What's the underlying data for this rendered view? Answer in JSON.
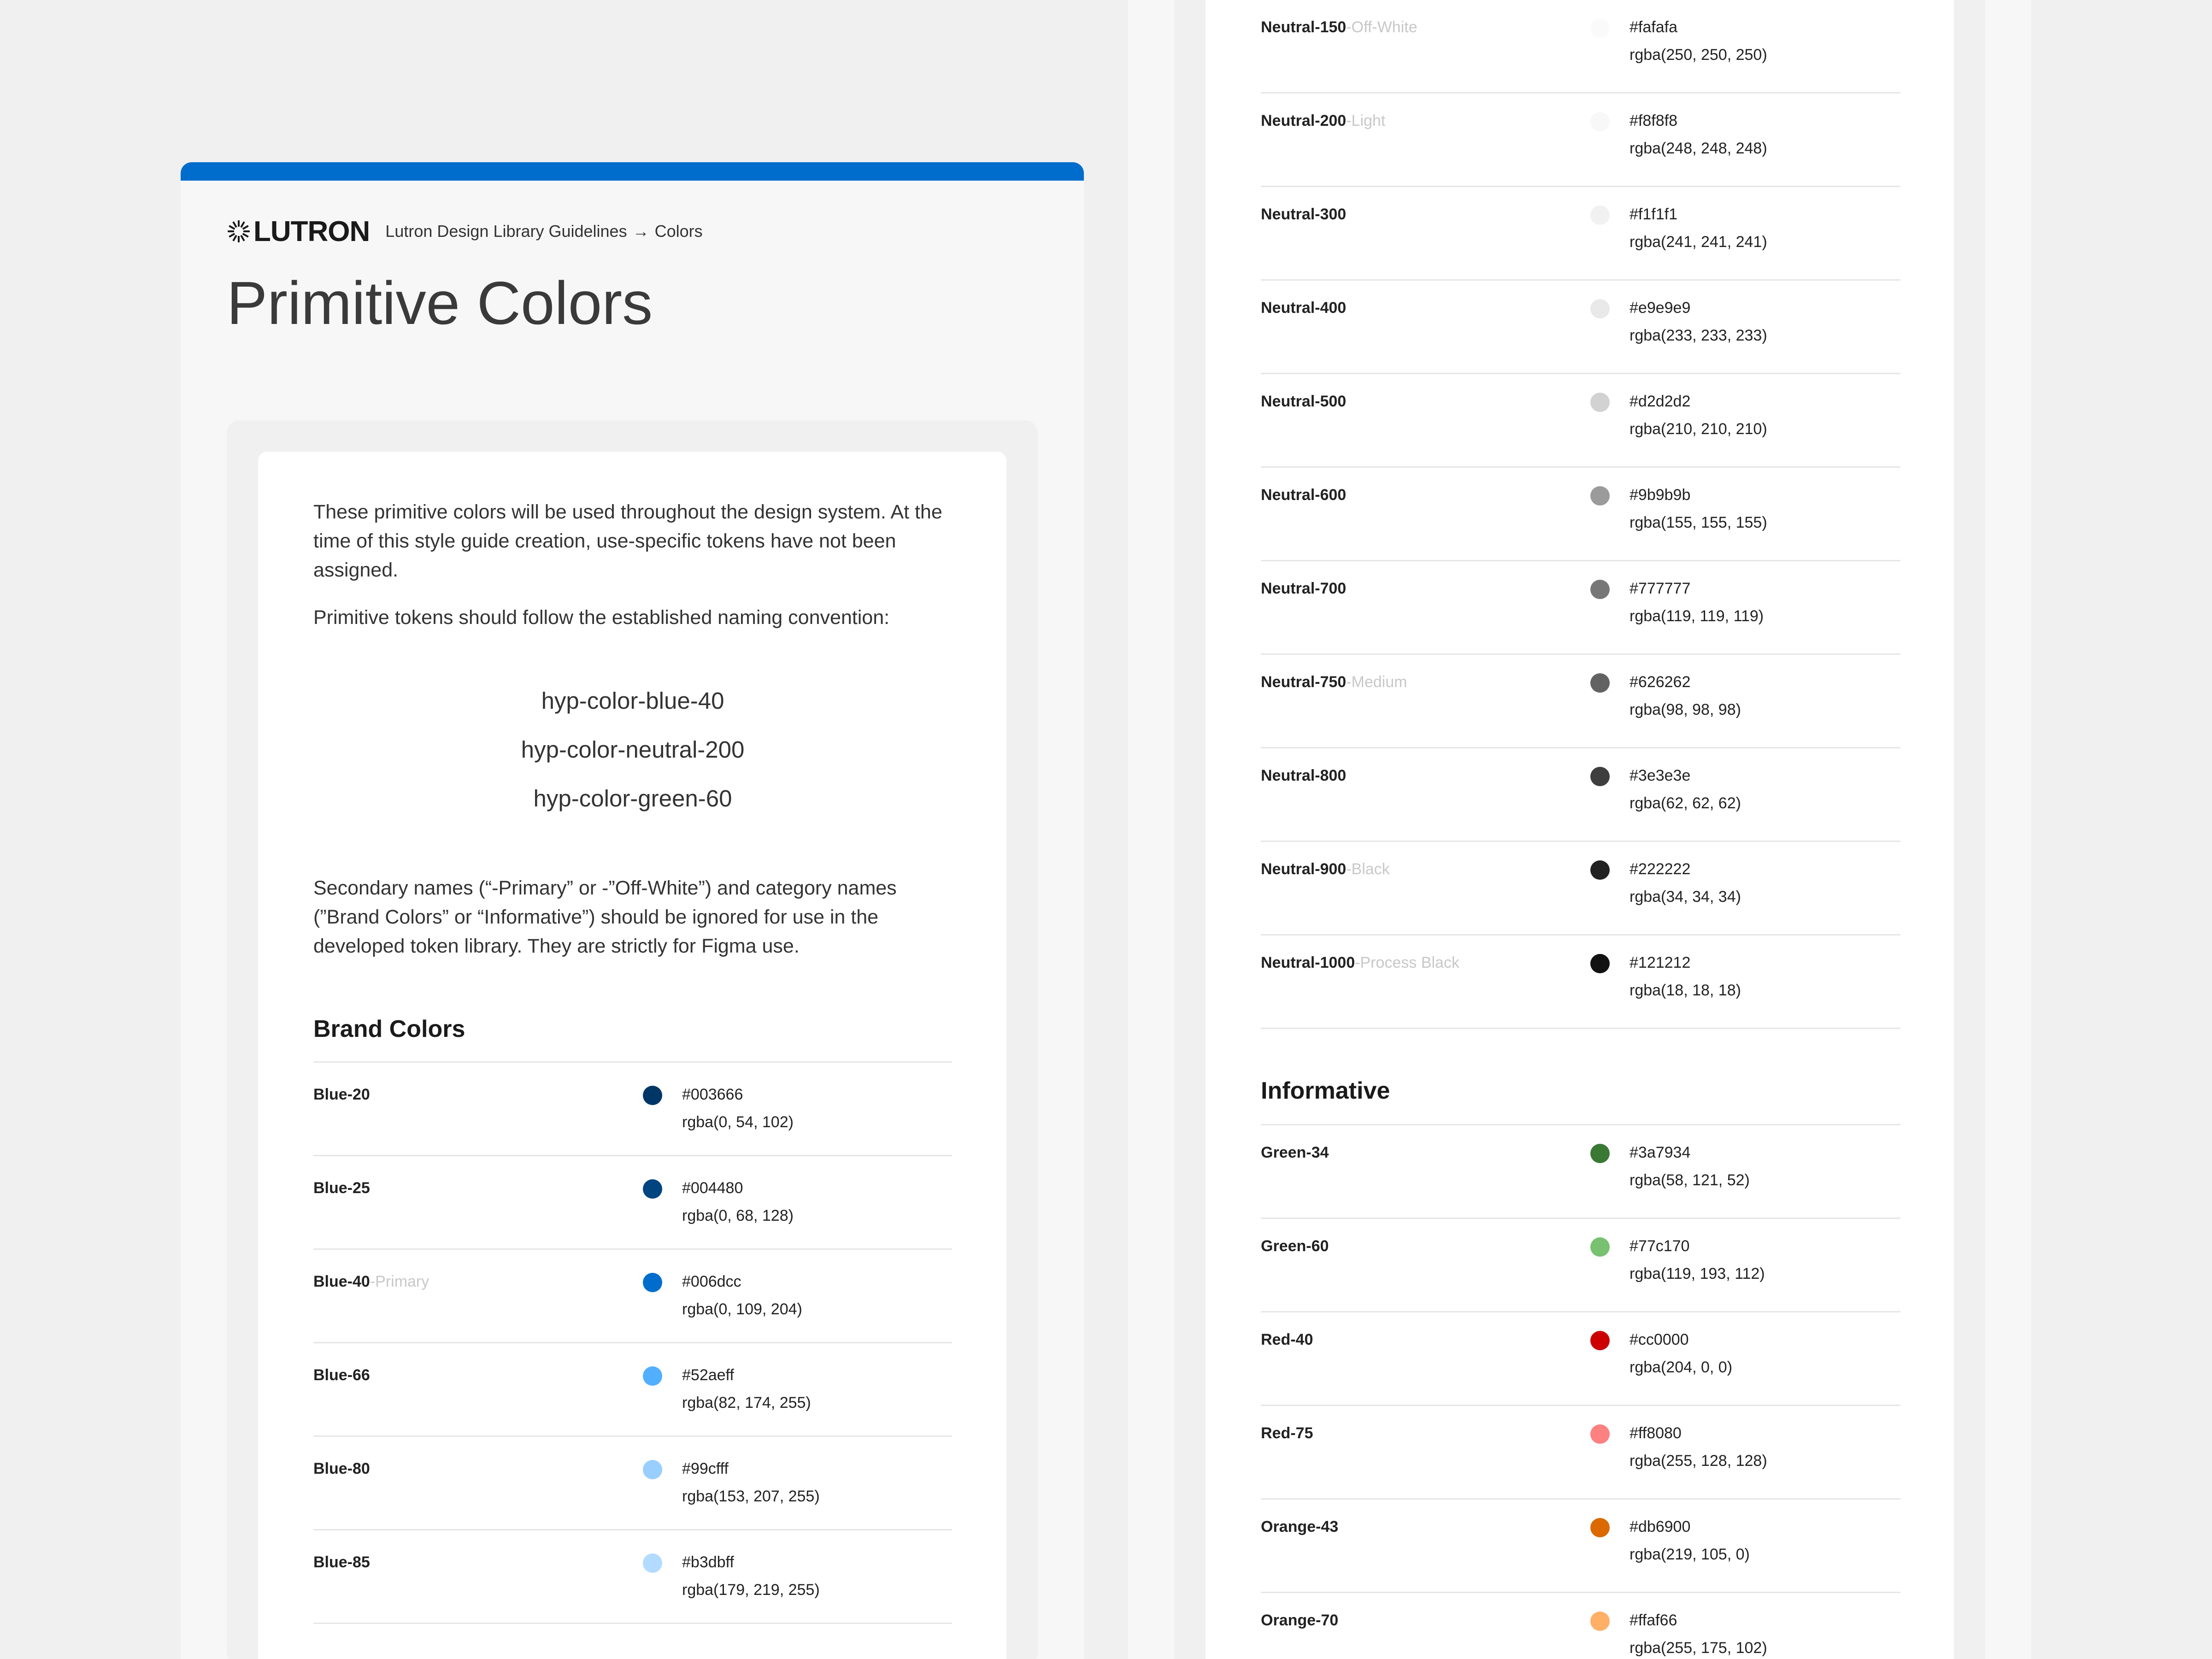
{
  "header": {
    "logo_text": "LUTRON",
    "breadcrumb_parent": "Lutron Design Library Guidelines",
    "breadcrumb_arrow": "→",
    "breadcrumb_current": "Colors",
    "accent_color": "#006dcc"
  },
  "page_title": "Primitive Colors",
  "intro": {
    "p1": "These primitive colors will be used throughout the design system. At the time of this style guide creation, use-specific tokens have not been assigned.",
    "p2": "Primitive tokens should follow the established naming convention:",
    "tokens": [
      "hyp-color-blue-40",
      "hyp-color-neutral-200",
      "hyp-color-green-60"
    ],
    "p3": "Secondary names (“-Primary” or -”Off-White”) and category names (”Brand Colors” or “Informative”) should be ignored for use in the developed token library. They are strictly for Figma use."
  },
  "brand_section": {
    "title": "Brand Colors",
    "items": [
      {
        "name": "Blue-20",
        "sub": "",
        "hex": "#003666",
        "rgba": "rgba(0, 54, 102)",
        "color": "#003666"
      },
      {
        "name": "Blue-25",
        "sub": "",
        "hex": "#004480",
        "rgba": "rgba(0, 68, 128)",
        "color": "#004480"
      },
      {
        "name": "Blue-40",
        "sub": "-Primary",
        "hex": "#006dcc",
        "rgba": "rgba(0, 109, 204)",
        "color": "#006dcc"
      },
      {
        "name": "Blue-66",
        "sub": "",
        "hex": "#52aeff",
        "rgba": "rgba(82, 174, 255)",
        "color": "#52aeff"
      },
      {
        "name": "Blue-80",
        "sub": "",
        "hex": "#99cfff",
        "rgba": "rgba(153, 207, 255)",
        "color": "#99cfff"
      },
      {
        "name": "Blue-85",
        "sub": "",
        "hex": "#b3dbff",
        "rgba": "rgba(179, 219, 255)",
        "color": "#b3dbff"
      }
    ]
  },
  "neutral_section": {
    "items": [
      {
        "name": "Neutral-150",
        "sub": "-Off-White",
        "hex": "#fafafa",
        "rgba": "rgba(250, 250, 250)",
        "color": "#fafafa"
      },
      {
        "name": "Neutral-200",
        "sub": "-Light",
        "hex": "#f8f8f8",
        "rgba": "rgba(248, 248, 248)",
        "color": "#f8f8f8"
      },
      {
        "name": "Neutral-300",
        "sub": "",
        "hex": "#f1f1f1",
        "rgba": "rgba(241, 241, 241)",
        "color": "#f1f1f1"
      },
      {
        "name": "Neutral-400",
        "sub": "",
        "hex": "#e9e9e9",
        "rgba": "rgba(233, 233, 233)",
        "color": "#e9e9e9"
      },
      {
        "name": "Neutral-500",
        "sub": "",
        "hex": "#d2d2d2",
        "rgba": "rgba(210, 210, 210)",
        "color": "#d2d2d2"
      },
      {
        "name": "Neutral-600",
        "sub": "",
        "hex": "#9b9b9b",
        "rgba": "rgba(155, 155, 155)",
        "color": "#9b9b9b"
      },
      {
        "name": "Neutral-700",
        "sub": "",
        "hex": "#777777",
        "rgba": "rgba(119, 119, 119)",
        "color": "#777777"
      },
      {
        "name": "Neutral-750",
        "sub": "-Medium",
        "hex": "#626262",
        "rgba": "rgba(98, 98, 98)",
        "color": "#626262"
      },
      {
        "name": "Neutral-800",
        "sub": "",
        "hex": "#3e3e3e",
        "rgba": "rgba(62, 62, 62)",
        "color": "#3e3e3e"
      },
      {
        "name": "Neutral-900",
        "sub": "-Black",
        "hex": "#222222",
        "rgba": "rgba(34, 34, 34)",
        "color": "#222222"
      },
      {
        "name": "Neutral-1000",
        "sub": "-Process Black",
        "hex": "#121212",
        "rgba": "rgba(18, 18, 18)",
        "color": "#121212"
      }
    ]
  },
  "informative_section": {
    "title": "Informative",
    "items": [
      {
        "name": "Green-34",
        "sub": "",
        "hex": "#3a7934",
        "rgba": "rgba(58, 121, 52)",
        "color": "#3a7934"
      },
      {
        "name": "Green-60",
        "sub": "",
        "hex": "#77c170",
        "rgba": "rgba(119, 193, 112)",
        "color": "#77c170"
      },
      {
        "name": "Red-40",
        "sub": "",
        "hex": "#cc0000",
        "rgba": "rgba(204, 0, 0)",
        "color": "#cc0000"
      },
      {
        "name": "Red-75",
        "sub": "",
        "hex": "#ff8080",
        "rgba": "rgba(255, 128, 128)",
        "color": "#ff8080"
      },
      {
        "name": "Orange-43",
        "sub": "",
        "hex": "#db6900",
        "rgba": "rgba(219, 105, 0)",
        "color": "#db6900"
      },
      {
        "name": "Orange-70",
        "sub": "",
        "hex": "#ffaf66",
        "rgba": "rgba(255, 175, 102)",
        "color": "#ffaf66"
      }
    ]
  }
}
